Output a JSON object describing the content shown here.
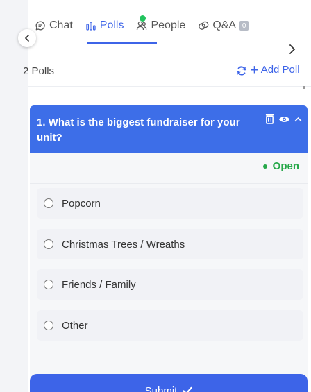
{
  "tabs": [
    {
      "label": "Chat",
      "icon": "chat-icon"
    },
    {
      "label": "Polls",
      "icon": "bar-chart-icon",
      "active": true,
      "notification": true
    },
    {
      "label": "People",
      "icon": "people-icon"
    },
    {
      "label": "Q&A",
      "icon": "qa-icon",
      "badge": "0"
    }
  ],
  "polls": {
    "count_label": "2 Polls",
    "add_label": "Add Poll",
    "add_plus": "+"
  },
  "poll": {
    "question": "1. What is the biggest fundraiser for your unit?",
    "status": "Open",
    "options": [
      "Popcorn",
      "Christmas Trees / Wreaths",
      "Friends / Family",
      "Other"
    ],
    "submit_label": "Submit"
  },
  "colors": {
    "accent": "#3d64e8",
    "header": "#3d6ee8",
    "open_status": "#27a84a",
    "notification": "#22c35e"
  }
}
